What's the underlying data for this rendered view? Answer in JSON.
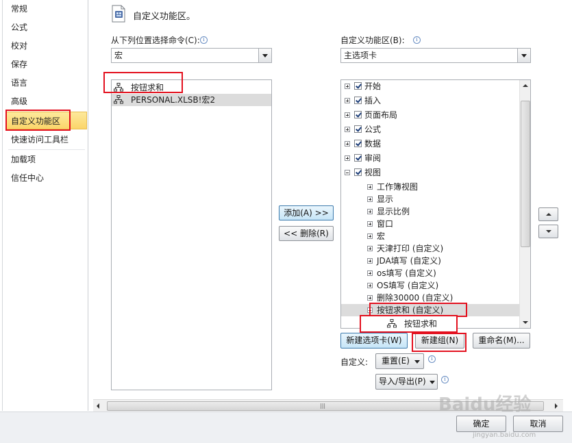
{
  "sidebar": {
    "items": [
      "常规",
      "公式",
      "校对",
      "保存",
      "语言",
      "高级",
      "自定义功能区",
      "快速访问工具栏",
      "加载项",
      "信任中心"
    ],
    "selected": "自定义功能区"
  },
  "header": {
    "title": "自定义功能区。"
  },
  "left_panel": {
    "label": "从下列位置选择命令(C):",
    "combo_value": "宏",
    "items": [
      "按钮求和",
      "PERSONAL.XLSB!宏2"
    ]
  },
  "middle": {
    "add_button": "添加(A) >>",
    "remove_button": "<< 删除(R)"
  },
  "right_panel": {
    "label": "自定义功能区(B):",
    "combo_value": "主选项卡",
    "tabs": [
      "开始",
      "插入",
      "页面布局",
      "公式",
      "数据",
      "审阅",
      "视图"
    ],
    "view_groups": [
      "工作簿视图",
      "显示",
      "显示比例",
      "窗口",
      "宏",
      "天津打印 (自定义)",
      "JDA填写 (自定义)",
      "os填写 (自定义)",
      "OS填写 (自定义)",
      "删除30000 (自定义)",
      "按钮求和 (自定义)"
    ],
    "sub_item": "按钮求和"
  },
  "actions": {
    "new_tab": "新建选项卡(W)",
    "new_group": "新建组(N)",
    "rename": "重命名(M)...",
    "customize_label": "自定义:",
    "reset": "重置(E)",
    "import_export": "导入/导出(P)"
  },
  "footer": {
    "ok": "确定",
    "cancel": "取消"
  },
  "watermark": {
    "text": "Baidu经验",
    "url": "jingyan.baidu.com"
  },
  "colors": {
    "highlight": "#e3101e",
    "selected_nav": "#fbd56a",
    "button_blue": "#c6e5f7"
  }
}
